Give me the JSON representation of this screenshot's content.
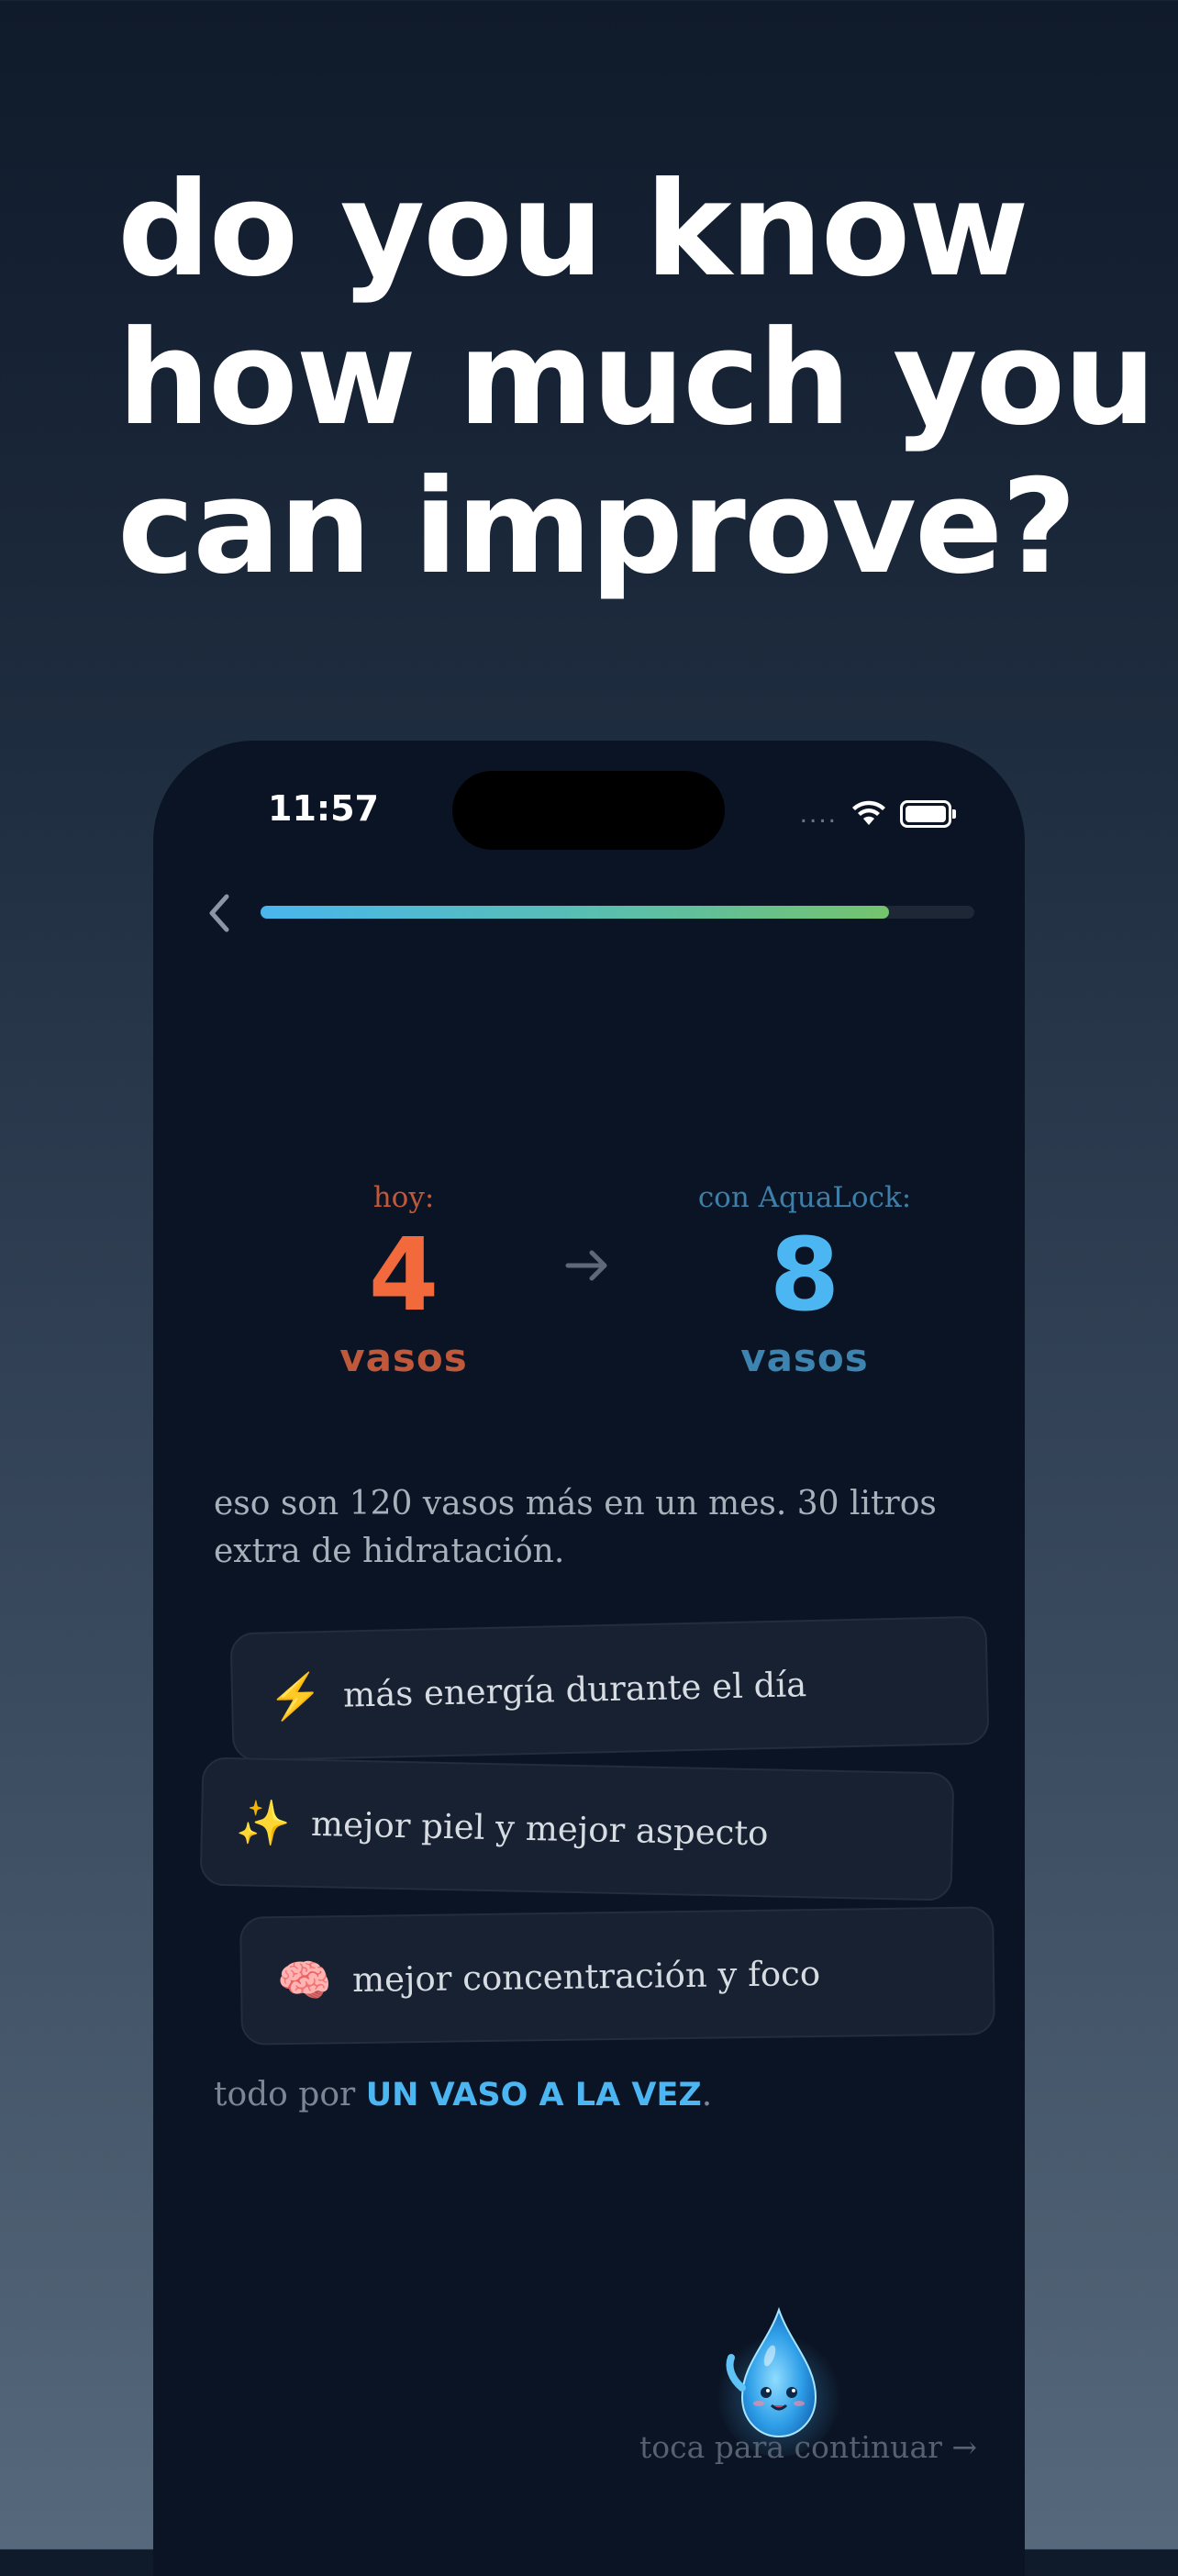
{
  "headline": {
    "lines": [
      "do you know",
      "how much you",
      "can improve?"
    ]
  },
  "status_bar": {
    "time": "11:57",
    "signal_dots": "....",
    "icons": [
      "wifi-icon",
      "battery-icon"
    ]
  },
  "onboarding": {
    "back_icon": "chevron-left-icon",
    "progress": 0.88,
    "today": {
      "label": "hoy:",
      "value": "4",
      "unit": "vasos"
    },
    "arrow_icon": "arrow-right-icon",
    "with_app": {
      "label": "con AquaLock:",
      "value": "8",
      "unit": "vasos"
    },
    "summary": "eso son 120 vasos más en un mes. 30 litros extra de hidratación.",
    "benefits": [
      {
        "icon": "⚡",
        "icon_name": "lightning-icon",
        "text": "más energía durante el día"
      },
      {
        "icon": "✨",
        "icon_name": "sparkles-icon",
        "text": "mejor piel y mejor aspecto"
      },
      {
        "icon": "🧠",
        "icon_name": "brain-icon",
        "text": "mejor concentración y foco"
      }
    ],
    "tagline_prefix": "todo por ",
    "tagline_highlight": "UN VASO A LA VEZ",
    "tagline_suffix": ".",
    "continue_text": "toca para continuar →"
  },
  "colors": {
    "today_accent": "#f26a3b",
    "app_accent": "#4cb6f2",
    "phone_bg": "#0b1424"
  }
}
